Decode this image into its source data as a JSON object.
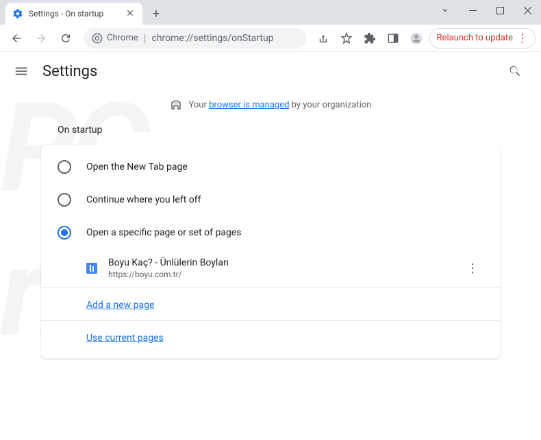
{
  "window": {
    "tab_title": "Settings - On startup"
  },
  "toolbar": {
    "omnibox_prefix": "Chrome",
    "omnibox_url": "chrome://settings/onStartup",
    "relaunch_label": "Relaunch to update"
  },
  "header": {
    "title": "Settings"
  },
  "managed": {
    "prefix": "Your ",
    "link": "browser is managed",
    "suffix": " by your organization"
  },
  "section": {
    "title": "On startup",
    "options": [
      {
        "label": "Open the New Tab page"
      },
      {
        "label": "Continue where you left off"
      },
      {
        "label": "Open a specific page or set of pages"
      }
    ],
    "page": {
      "title": "Boyu Kaç? - Ünlülerin Boyları",
      "url": "https://boyu.com.tr/"
    },
    "add_link": "Add a new page",
    "use_current_link": "Use current pages"
  }
}
